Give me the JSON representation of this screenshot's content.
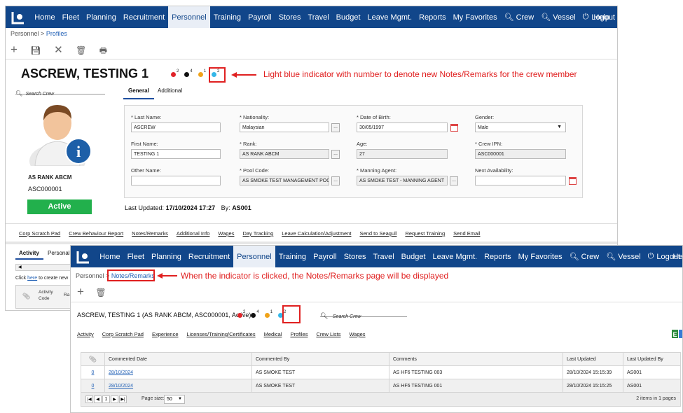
{
  "back_window": {
    "nav": {
      "items": [
        "Home",
        "Fleet",
        "Planning",
        "Recruitment",
        "Personnel",
        "Training",
        "Payroll",
        "Stores",
        "Travel",
        "Budget",
        "Leave Mgmt.",
        "Reports",
        "My Favorites"
      ],
      "crew": "Crew",
      "vessel": "Vessel",
      "logout": "Logout",
      "help": "Help"
    },
    "breadcrumb": {
      "root": "Personnel",
      "sep": ">",
      "current": "Profiles"
    },
    "crew_name": "ASCREW, TESTING 1",
    "indicators": [
      {
        "color": "#e0242a",
        "count": "2"
      },
      {
        "color": "#111111",
        "count": "4"
      },
      {
        "color": "#f0a31a",
        "count": "1"
      },
      {
        "color": "#34b7e8",
        "count": "2"
      }
    ],
    "annotation": "Light blue indicator with number to denote new Notes/Remarks for the crew member",
    "search_placeholder": "Search Crew",
    "tabs": [
      "General",
      "Additional"
    ],
    "form": {
      "last_name": {
        "label": "* Last Name:",
        "value": "ASCREW"
      },
      "nationality": {
        "label": "* Nationality:",
        "value": "Malaysian"
      },
      "dob": {
        "label": "* Date of Birth:",
        "value": "30/05/1997"
      },
      "gender": {
        "label": "Gender:",
        "value": "Male"
      },
      "first_name": {
        "label": "First Name:",
        "value": "TESTING 1"
      },
      "rank": {
        "label": "* Rank:",
        "value": "AS RANK ABCM"
      },
      "age": {
        "label": "Age:",
        "value": "27"
      },
      "crew_ipn": {
        "label": "* Crew IPN:",
        "value": "ASC000001"
      },
      "other_name": {
        "label": "Other Name:",
        "value": ""
      },
      "pool_code": {
        "label": "* Pool Code:",
        "value": "AS SMOKE TEST MANAGEMENT POOL"
      },
      "manning_agent": {
        "label": "* Manning Agent:",
        "value": "AS SMOKE TEST - MANNING AGENT"
      },
      "next_availability": {
        "label": "Next Availability:",
        "value": ""
      },
      "dots": "..."
    },
    "last_updated_label": "Last Updated:",
    "last_updated_value": "17/10/2024 17:27",
    "by_label": "By:",
    "by_value": "AS001",
    "profile": {
      "rank": "AS RANK ABCM",
      "code": "ASC000001",
      "status": "Active"
    },
    "links": [
      "Corp Scratch Pad",
      "Crew Behaviour Report",
      "Notes/Remarks",
      "Additional Info",
      "Wages",
      "Day Tracking",
      "Leave Calculation/Adjustment",
      "Send to Seagull",
      "Request Training",
      "Send Email"
    ],
    "bottom_tabs": [
      "Activity",
      "Personal"
    ],
    "click_text": "Click",
    "here": "here",
    "to_create": "to create new",
    "activity_code": "Activity Code",
    "ra": "Ra"
  },
  "front_window": {
    "nav": {
      "items": [
        "Home",
        "Fleet",
        "Planning",
        "Recruitment",
        "Personnel",
        "Training",
        "Payroll",
        "Stores",
        "Travel",
        "Budget",
        "Leave Mgmt.",
        "Reports",
        "My Favorites"
      ],
      "crew": "Crew",
      "vessel": "Vessel",
      "logout": "Logout",
      "help": "Help"
    },
    "breadcrumb": {
      "root": "Personnel",
      "sep": ">",
      "current": "Notes/Remarks"
    },
    "annotation": "When the indicator is clicked, the Notes/Remarks page will be displayed",
    "crew_title": "ASCREW, TESTING 1 (AS RANK ABCM, ASC000001, Active)",
    "search_placeholder": "Search Crew",
    "links": [
      "Activity",
      "Corp Scratch Pad",
      "Experience",
      "Licenses/Training/Certificates",
      "Medical",
      "Profiles",
      "Crew Lists",
      "Wages"
    ],
    "table": {
      "headers": [
        "Commented Date",
        "Commented By",
        "Comments",
        "Last Updated",
        "Last Updated By"
      ],
      "rows": [
        {
          "num": "0",
          "date": "28/10/2024",
          "by": "AS SMOKE TEST",
          "comment": "AS HF6 TESTING 003",
          "updated": "28/10/2024 15:15:39",
          "updated_by": "AS001"
        },
        {
          "num": "0",
          "date": "28/10/2024",
          "by": "AS SMOKE TEST",
          "comment": "AS HF6 TESTING 001",
          "updated": "28/10/2024 15:15:25",
          "updated_by": "AS001"
        }
      ]
    },
    "pager": {
      "page": "1",
      "page_size_label": "Page size:",
      "page_size": "50",
      "summary": "2 items in 1 pages"
    }
  }
}
